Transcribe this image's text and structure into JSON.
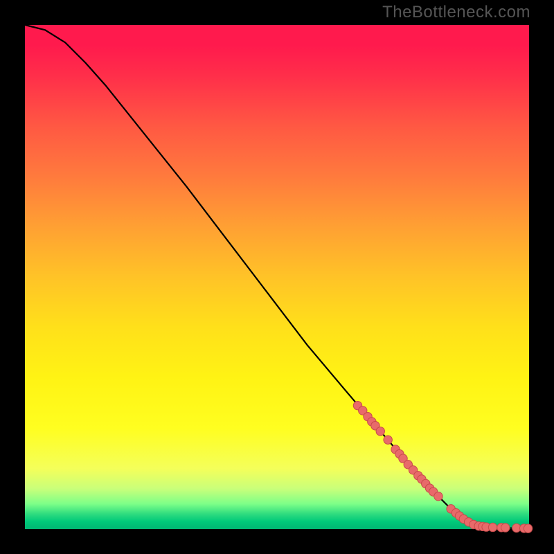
{
  "watermark": "TheBottleneck.com",
  "chart_data": {
    "type": "line",
    "title": "",
    "xlabel": "",
    "ylabel": "",
    "xlim": [
      0,
      100
    ],
    "ylim": [
      0,
      100
    ],
    "curve": [
      {
        "x": 0,
        "y": 100
      },
      {
        "x": 4,
        "y": 99
      },
      {
        "x": 8,
        "y": 96.5
      },
      {
        "x": 12,
        "y": 92.5
      },
      {
        "x": 16,
        "y": 88
      },
      {
        "x": 24,
        "y": 78
      },
      {
        "x": 32,
        "y": 68
      },
      {
        "x": 40,
        "y": 57.5
      },
      {
        "x": 48,
        "y": 47
      },
      {
        "x": 56,
        "y": 36.5
      },
      {
        "x": 64,
        "y": 27
      },
      {
        "x": 70,
        "y": 20
      },
      {
        "x": 76,
        "y": 13
      },
      {
        "x": 80,
        "y": 8.5
      },
      {
        "x": 84,
        "y": 4.5
      },
      {
        "x": 87,
        "y": 2
      },
      {
        "x": 89,
        "y": 1
      },
      {
        "x": 90,
        "y": 0.6
      },
      {
        "x": 93,
        "y": 0.3
      },
      {
        "x": 96,
        "y": 0.2
      },
      {
        "x": 100,
        "y": 0.1
      }
    ],
    "markers": [
      {
        "x": 66,
        "y": 24.5
      },
      {
        "x": 67,
        "y": 23.5
      },
      {
        "x": 68,
        "y": 22.3
      },
      {
        "x": 68.8,
        "y": 21.3
      },
      {
        "x": 69.5,
        "y": 20.5
      },
      {
        "x": 70.5,
        "y": 19.4
      },
      {
        "x": 72,
        "y": 17.7
      },
      {
        "x": 73.5,
        "y": 15.8
      },
      {
        "x": 74.3,
        "y": 14.9
      },
      {
        "x": 75,
        "y": 14
      },
      {
        "x": 76,
        "y": 12.8
      },
      {
        "x": 77,
        "y": 11.7
      },
      {
        "x": 78,
        "y": 10.6
      },
      {
        "x": 78.7,
        "y": 9.9
      },
      {
        "x": 79.5,
        "y": 9
      },
      {
        "x": 80.3,
        "y": 8.1
      },
      {
        "x": 81,
        "y": 7.4
      },
      {
        "x": 82,
        "y": 6.5
      },
      {
        "x": 84.5,
        "y": 4
      },
      {
        "x": 85.5,
        "y": 3.2
      },
      {
        "x": 86.2,
        "y": 2.6
      },
      {
        "x": 87,
        "y": 2
      },
      {
        "x": 88,
        "y": 1.4
      },
      {
        "x": 89,
        "y": 0.9
      },
      {
        "x": 90,
        "y": 0.6
      },
      {
        "x": 90.8,
        "y": 0.5
      },
      {
        "x": 91.5,
        "y": 0.4
      },
      {
        "x": 92.8,
        "y": 0.35
      },
      {
        "x": 94.5,
        "y": 0.3
      },
      {
        "x": 95.3,
        "y": 0.28
      },
      {
        "x": 97.5,
        "y": 0.22
      },
      {
        "x": 99,
        "y": 0.15
      },
      {
        "x": 99.8,
        "y": 0.12
      }
    ],
    "colors": {
      "curve": "#000000",
      "marker_fill": "#e86a6a",
      "marker_stroke": "#c74a4a",
      "gradient": [
        "#ff1a4d",
        "#ffa033",
        "#fff314",
        "#00c97a"
      ]
    }
  }
}
